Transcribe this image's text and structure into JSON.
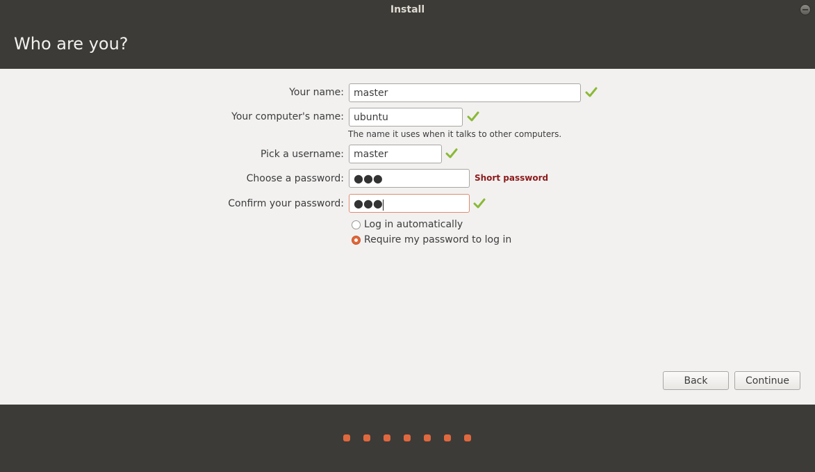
{
  "window": {
    "title": "Install"
  },
  "page": {
    "heading": "Who are you?"
  },
  "form": {
    "name_label": "Your name:",
    "name_value": "master",
    "computer_label": "Your computer's name:",
    "computer_value": "ubuntu",
    "computer_hint": "The name it uses when it talks to other computers.",
    "username_label": "Pick a username:",
    "username_value": "master",
    "password_label": "Choose a password:",
    "password_value": "●●●",
    "password_warning": "Short password",
    "confirm_label": "Confirm your password:",
    "confirm_value": "●●●",
    "login_options": [
      {
        "label": "Log in automatically",
        "selected": false
      },
      {
        "label": "Require my password to log in",
        "selected": true
      }
    ]
  },
  "buttons": {
    "back": "Back",
    "continue": "Continue"
  },
  "progress": {
    "step_count": 7
  },
  "colors": {
    "accent": "#e0683e",
    "check": "#8ab935",
    "warning": "#8b1a1a",
    "dark": "#3c3b37"
  },
  "icons": {
    "valid": "check-icon",
    "minimize": "minimize-icon"
  }
}
